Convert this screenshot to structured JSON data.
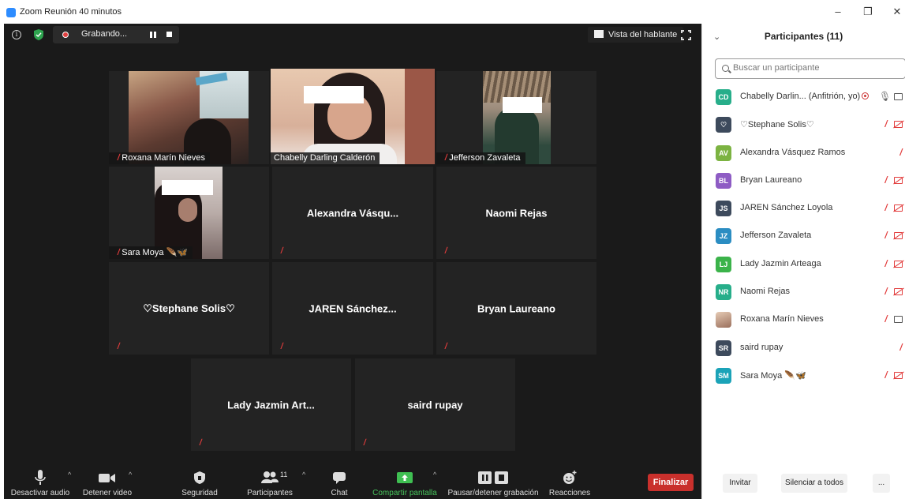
{
  "window": {
    "title": "Zoom Reunión 40 minutos",
    "controls": [
      "–",
      "❐",
      "✕"
    ]
  },
  "meeting": {
    "recording_label": "Grabando...",
    "speaker_view_label": "Vista del hablante"
  },
  "tiles": [
    {
      "name": "Roxana Marín Nieves"
    },
    {
      "name": "Chabelly Darling Calderón"
    },
    {
      "name": "Jefferson Zavaleta"
    },
    {
      "name": "Sara Moya 🪶🦋"
    },
    {
      "name": "Alexandra  Vásqu..."
    },
    {
      "name": "Naomi Rejas"
    },
    {
      "name": "♡Stephane Solis♡"
    },
    {
      "name": "JAREN  Sánchez..."
    },
    {
      "name": "Bryan Laureano"
    },
    {
      "name": "Lady Jazmin Art..."
    },
    {
      "name": "saird rupay"
    }
  ],
  "toolbar": {
    "audio": "Desactivar audio",
    "video": "Detener video",
    "security": "Seguridad",
    "participants": "Participantes",
    "participants_count": "11",
    "chat": "Chat",
    "share": "Compartir pantalla",
    "pause_recording": "Pausar/detener grabación",
    "reactions": "Reacciones",
    "end": "Finalizar"
  },
  "panel": {
    "title": "Participantes (11)",
    "search_placeholder": "Buscar un participante",
    "participants": [
      {
        "initials": "CD",
        "name": "Chabelly Darlin... (Anfitrión, yo)",
        "color": "#27ae8a"
      },
      {
        "initials": "♡",
        "name": "♡Stephane Solis♡",
        "color": "#3d4a5c"
      },
      {
        "initials": "AV",
        "name": "Alexandra Vásquez Ramos",
        "color": "#7cb342"
      },
      {
        "initials": "BL",
        "name": "Bryan Laureano",
        "color": "#8e5cc4"
      },
      {
        "initials": "JS",
        "name": "JAREN Sánchez Loyola",
        "color": "#3d4a5c"
      },
      {
        "initials": "JZ",
        "name": "Jefferson Zavaleta",
        "color": "#2b8dc2"
      },
      {
        "initials": "LJ",
        "name": "Lady Jazmin Arteaga",
        "color": "#3bb34a"
      },
      {
        "initials": "NR",
        "name": "Naomi Rejas",
        "color": "#27ae8a"
      },
      {
        "initials": "",
        "name": "Roxana Marín Nieves",
        "color": "#c9a48a"
      },
      {
        "initials": "SR",
        "name": "saird rupay",
        "color": "#3d4a5c"
      },
      {
        "initials": "SM",
        "name": "Sara Moya 🪶🦋",
        "color": "#1ba3b8"
      }
    ],
    "invite": "Invitar",
    "mute_all": "Silenciar a todos",
    "more": "..."
  }
}
